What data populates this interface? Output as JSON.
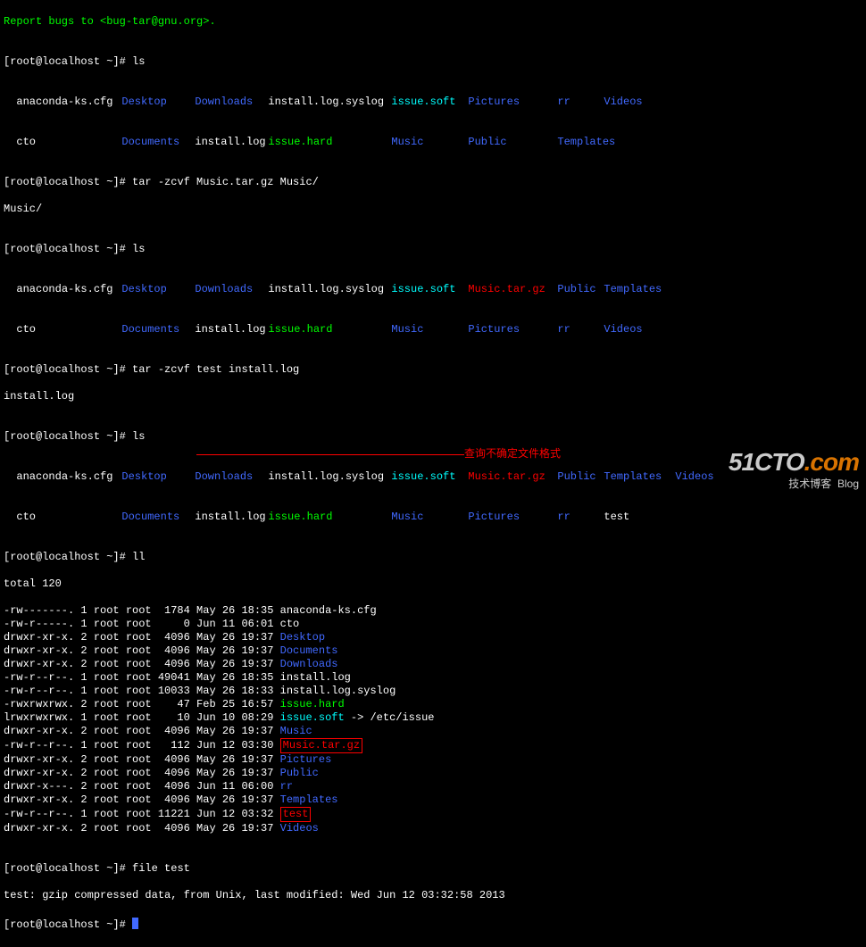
{
  "header_line": "Report bugs to <bug-tar@gnu.org>.",
  "prompt": "[root@localhost ~]# ",
  "prompt_music": "Music/",
  "cmd": {
    "ls": "ls",
    "tar1": "tar -zcvf Music.tar.gz Music/",
    "tar2": "tar -zcvf test install.log",
    "ll": "ll",
    "file": "file test"
  },
  "ls1": {
    "r1": [
      "anaconda-ks.cfg",
      "Desktop",
      "Downloads",
      "install.log.syslog",
      "issue.soft",
      "Pictures",
      "rr",
      "Videos"
    ],
    "r2": [
      "cto",
      "Documents",
      "install.log",
      "issue.hard",
      "Music",
      "Public",
      "Templates",
      ""
    ]
  },
  "ls2": {
    "r1": [
      "anaconda-ks.cfg",
      "Desktop",
      "Downloads",
      "install.log.syslog",
      "issue.soft",
      "Music.tar.gz",
      "Public",
      "Templates"
    ],
    "r2": [
      "cto",
      "Documents",
      "install.log",
      "issue.hard",
      "Music",
      "Pictures",
      "rr",
      "Videos"
    ]
  },
  "install_log_echo": "install.log",
  "ls3": {
    "r1": [
      "anaconda-ks.cfg",
      "Desktop",
      "Downloads",
      "install.log.syslog",
      "issue.soft",
      "Music.tar.gz",
      "Public",
      "Templates",
      "Videos"
    ],
    "r2": [
      "cto",
      "Documents",
      "install.log",
      "issue.hard",
      "Music",
      "Pictures",
      "rr",
      "test",
      ""
    ]
  },
  "ll_total": "total 120",
  "ll": [
    {
      "perm": "-rw-------. 1 root root  1784 May 26 18:35 ",
      "name": "anaconda-ks.cfg",
      "cls": "white"
    },
    {
      "perm": "-rw-r-----. 1 root root     0 Jun 11 06:01 ",
      "name": "cto",
      "cls": "white"
    },
    {
      "perm": "drwxr-xr-x. 2 root root  4096 May 26 19:37 ",
      "name": "Desktop",
      "cls": "blue"
    },
    {
      "perm": "drwxr-xr-x. 2 root root  4096 May 26 19:37 ",
      "name": "Documents",
      "cls": "blue"
    },
    {
      "perm": "drwxr-xr-x. 2 root root  4096 May 26 19:37 ",
      "name": "Downloads",
      "cls": "blue"
    },
    {
      "perm": "-rw-r--r--. 1 root root 49041 May 26 18:35 ",
      "name": "install.log",
      "cls": "white"
    },
    {
      "perm": "-rw-r--r--. 1 root root 10033 May 26 18:33 ",
      "name": "install.log.syslog",
      "cls": "white"
    },
    {
      "perm": "-rwxrwxrwx. 2 root root    47 Feb 25 16:57 ",
      "name": "issue.hard",
      "cls": "green"
    },
    {
      "perm": "lrwxrwxrwx. 1 root root    10 Jun 10 08:29 ",
      "name": "issue.soft",
      "cls": "cyan",
      "arrow": " -> /etc/issue"
    },
    {
      "perm": "drwxr-xr-x. 2 root root  4096 May 26 19:37 ",
      "name": "Music",
      "cls": "blue"
    },
    {
      "perm": "-rw-r--r--. 1 root root   112 Jun 12 03:30 ",
      "name": "Music.tar.gz",
      "cls": "red",
      "box": true
    },
    {
      "perm": "drwxr-xr-x. 2 root root  4096 May 26 19:37 ",
      "name": "Pictures",
      "cls": "blue"
    },
    {
      "perm": "drwxr-xr-x. 2 root root  4096 May 26 19:37 ",
      "name": "Public",
      "cls": "blue"
    },
    {
      "perm": "drwxr-x---. 2 root root  4096 Jun 11 06:00 ",
      "name": "rr",
      "cls": "blue"
    },
    {
      "perm": "drwxr-xr-x. 2 root root  4096 May 26 19:37 ",
      "name": "Templates",
      "cls": "blue"
    },
    {
      "perm": "-rw-r--r--. 1 root root 11221 Jun 12 03:32 ",
      "name": "test",
      "cls": "red",
      "box": true
    },
    {
      "perm": "drwxr-xr-x. 2 root root  4096 May 26 19:37 ",
      "name": "Videos",
      "cls": "blue"
    }
  ],
  "file_out": "test: gzip compressed data, from Unix, last modified: Wed Jun 12 03:32:58 2013",
  "annotation": "查询不确定文件格式",
  "watermark": {
    "main": "51CTO",
    "suffix": ".com",
    "sub": "技术博客",
    "tag": "Blog"
  }
}
